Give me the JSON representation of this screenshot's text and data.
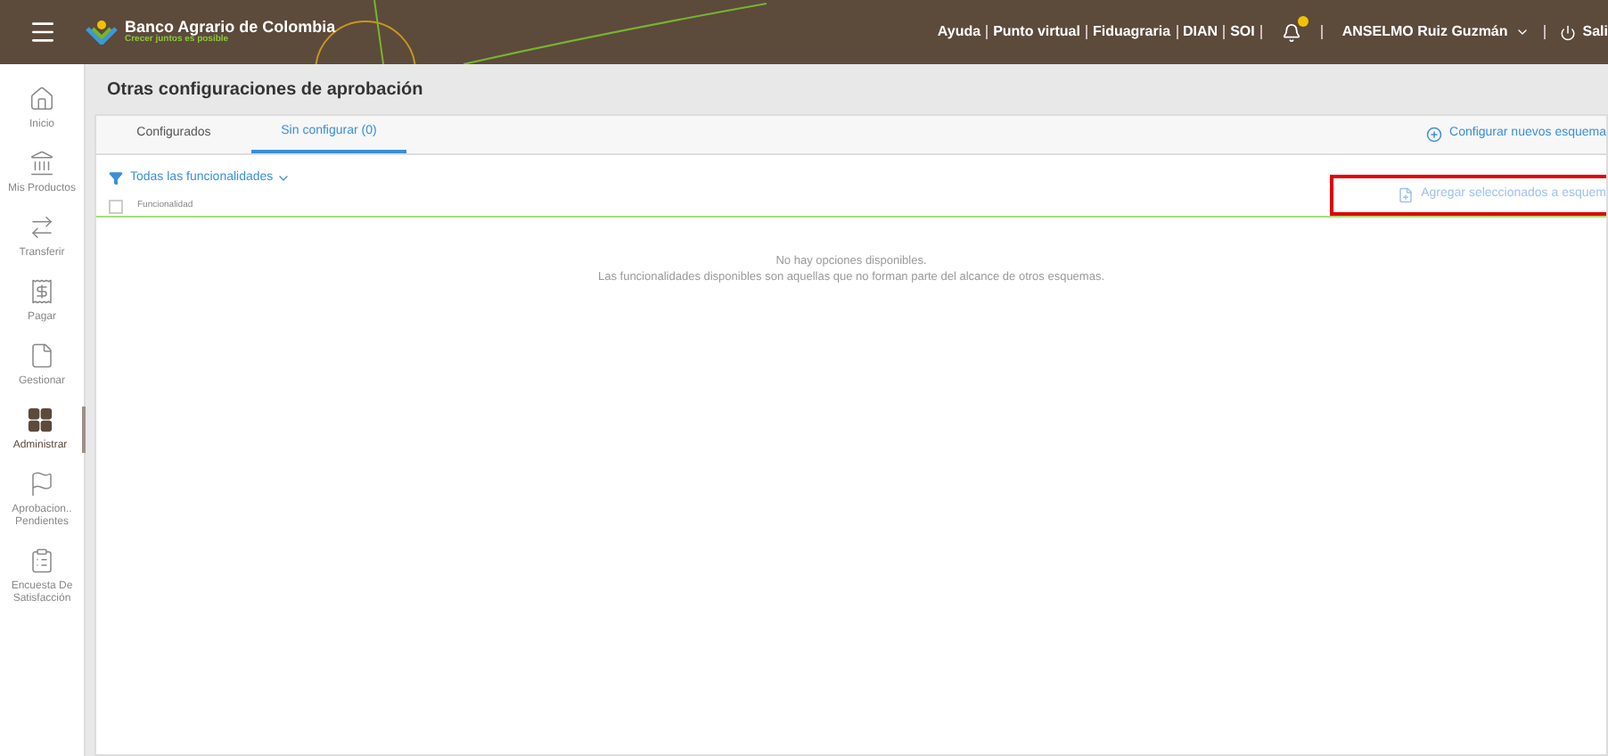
{
  "header": {
    "brand": "Banco Agrario de Colombia",
    "slogan": "Crecer juntos es posible",
    "links": [
      "Ayuda",
      "Punto virtual",
      "Fiduagraria",
      "DIAN",
      "SOI"
    ],
    "user": "ANSELMO Ruiz Guzmán",
    "logout": "Sali"
  },
  "sidebar": {
    "items": [
      {
        "kind": "home",
        "label": "Inicio",
        "selected": false
      },
      {
        "kind": "bank",
        "label": "Mis Productos",
        "selected": false
      },
      {
        "kind": "transfer",
        "label": "Transferir",
        "selected": false
      },
      {
        "kind": "pay",
        "label": "Pagar",
        "selected": false
      },
      {
        "kind": "file",
        "label": "Gestionar",
        "selected": false
      },
      {
        "kind": "grid",
        "label": "Administrar",
        "selected": true
      },
      {
        "kind": "flag",
        "label": "Aprobacion.. Pendientes",
        "selected": false
      },
      {
        "kind": "survey",
        "label": "Encuesta De Satisfacción",
        "selected": false
      }
    ]
  },
  "page": {
    "title": "Otras configuraciones de aprobación",
    "tabs": [
      {
        "label": "Configurados",
        "selected": false
      },
      {
        "label": "Sin configurar (0)",
        "selected": true
      }
    ],
    "configure_link": "Configurar nuevos esquema",
    "filter": "Todas las funcionalidades",
    "add_button": "Agregar seleccionados a esquem",
    "add_highlighted": true,
    "column": "Funcionalidad",
    "select_all_checked": false,
    "empty_title": "No hay opciones disponibles.",
    "empty_text": "Las funcionalidades disponibles son aquellas que no forman parte del alcance de otros esquemas."
  }
}
